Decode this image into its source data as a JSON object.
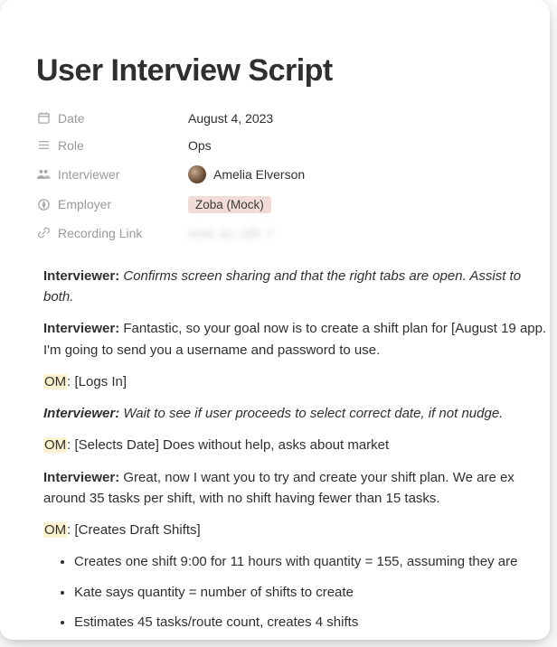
{
  "title": "User Interview Script",
  "props": {
    "date": {
      "label": "Date",
      "value": "August 4, 2023"
    },
    "role": {
      "label": "Role",
      "value": "Ops"
    },
    "interviewer": {
      "label": "Interviewer",
      "value": "Amelia Elverson"
    },
    "employer": {
      "label": "Employer",
      "tag": "Zoba (Mock)"
    },
    "recording": {
      "label": "Recording Link",
      "placeholder": "xnw ac ofk 7"
    }
  },
  "transcript": {
    "p1_label": "Interviewer:",
    "p1_text": "Confirms screen sharing and that the right tabs are open. Assist to both.",
    "p2_label": "Interviewer:",
    "p2_text": "Fantastic, so your goal now is to create a shift plan for [August 19 app. I'm going to send you a username and password to use.",
    "p3_om": "OM",
    "p3_rest": ": [Logs In]",
    "p4_label": "Interviewer:",
    "p4_text": "Wait to see if user proceeds to select correct date, if not nudge.",
    "p5_om": "OM",
    "p5_rest": ": [Selects Date] Does without help, asks about market",
    "p6_label": "Interviewer:",
    "p6_text": "Great, now I want you to try and create your shift plan. We are ex around 35 tasks per shift, with no shift having fewer than 15 tasks.",
    "p7_om": "OM",
    "p7_rest": ": [Creates Draft Shifts]",
    "bullets": [
      "Creates one shift 9:00 for 11 hours with quantity = 155, assuming they are",
      "Kate says quantity = number of shifts to create",
      "Estimates 45 tasks/route count, creates 4 shifts"
    ]
  }
}
